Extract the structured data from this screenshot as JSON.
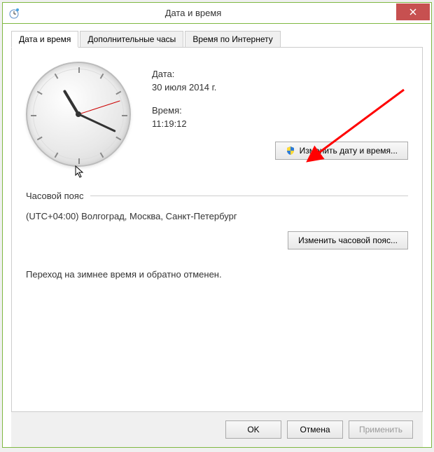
{
  "window": {
    "title": "Дата и время"
  },
  "tabs": {
    "datetime": "Дата и время",
    "additional": "Дополнительные часы",
    "internet": "Время по Интернету"
  },
  "date": {
    "label": "Дата:",
    "value": "30 июля 2014 г."
  },
  "time": {
    "label": "Время:",
    "value": "11:19:12"
  },
  "buttons": {
    "change_datetime": "Изменить дату и время...",
    "change_timezone": "Изменить часовой пояс...",
    "ok": "OK",
    "cancel": "Отмена",
    "apply": "Применить"
  },
  "timezone": {
    "header": "Часовой пояс",
    "value": "(UTC+04:00) Волгоград, Москва, Санкт-Петербург"
  },
  "dst": {
    "info": "Переход на зимнее время и обратно отменен."
  }
}
